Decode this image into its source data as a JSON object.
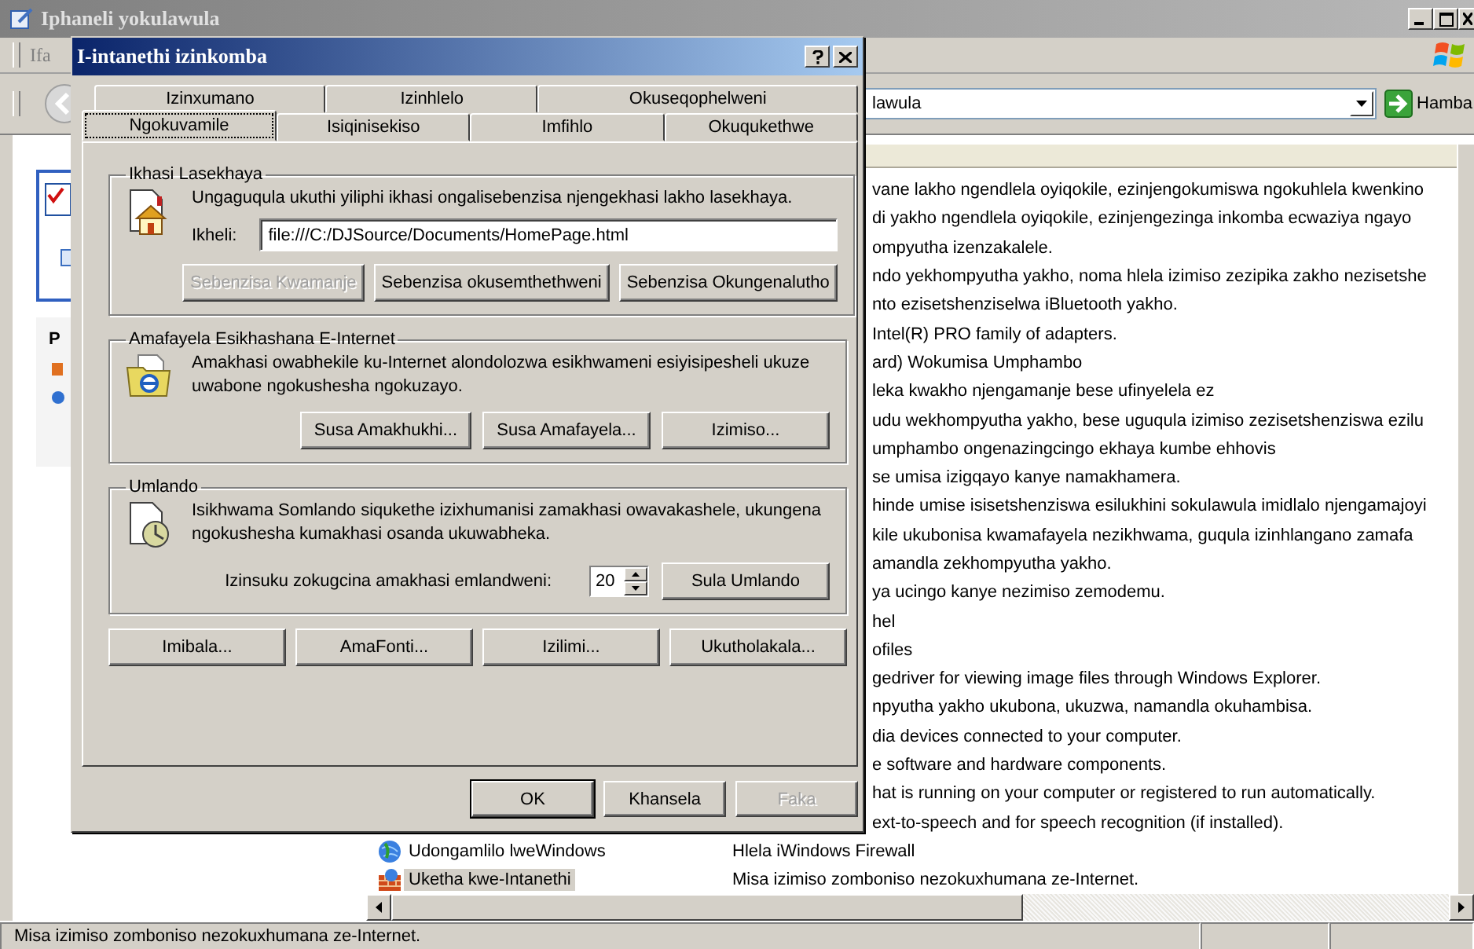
{
  "window": {
    "title": "Iphaneli yokulawula",
    "menu": [
      "Ifa"
    ],
    "address": "lawula",
    "go_button": "Hamba"
  },
  "left_panel": {
    "heading": "P"
  },
  "list": {
    "rows": [
      {
        "kind": "covered",
        "description": "vane lakho ngendlela oyiqokile, ezinjengokumiswa ngokuhlela kwenkino",
        "selected": false
      },
      {
        "kind": "covered",
        "description": "di yakho ngendlela oyiqokile, ezinjengezinga inkomba ecwaziya ngayo",
        "selected": false
      },
      {
        "kind": "covered",
        "description": "ompyutha izenzakalele.",
        "selected": false
      },
      {
        "kind": "covered",
        "description": "ndo yekhompyutha yakho, noma hlela izimiso zezipika zakho nezisetshe",
        "selected": false
      },
      {
        "kind": "covered",
        "description": "nto ezisetshenziselwa iBluetooth yakho.",
        "selected": false
      },
      {
        "kind": "covered",
        "description": "Intel(R) PRO family of adapters.",
        "selected": false
      },
      {
        "kind": "covered",
        "description": "ard) Wokumisa Umphambo",
        "selected": false
      },
      {
        "kind": "covered",
        "description": "leka kwakho njengamanje bese ufinyelela ez",
        "selected": false
      },
      {
        "kind": "covered",
        "description": "udu wekhompyutha yakho, bese uguqula izimiso zezisetshenziswa ezilu",
        "selected": false
      },
      {
        "kind": "covered",
        "description": "umphambo ongenazingcingo ekhaya kumbe ehhovis",
        "selected": false
      },
      {
        "kind": "covered",
        "description": "se umisa izigqayo kanye namakhamera.",
        "selected": false
      },
      {
        "kind": "covered",
        "description": "hinde umise isisetshenziswa esilukhini sokulawula imidlalo njengamajoyi",
        "selected": false
      },
      {
        "kind": "covered",
        "description": "kile ukubonisa kwamafayela nezikhwama, guqula izinhlangano zamafa",
        "selected": false
      },
      {
        "kind": "covered",
        "description": "amandla zekhompyutha yakho.",
        "selected": false
      },
      {
        "kind": "covered",
        "description": "ya ucingo kanye nezimiso zemodemu.",
        "selected": false
      },
      {
        "kind": "covered",
        "description": "hel",
        "selected": false
      },
      {
        "kind": "covered",
        "description": "ofiles",
        "selected": false
      },
      {
        "kind": "covered",
        "description": "gedriver for viewing image files through Windows Explorer.",
        "selected": false
      },
      {
        "kind": "covered",
        "description": "npyutha yakho ukubona, ukuzwa, namandla okuhambisa.",
        "selected": false
      },
      {
        "kind": "covered",
        "description": "dia devices connected to your computer.",
        "selected": false
      },
      {
        "kind": "covered",
        "description": "e software and hardware components.",
        "selected": false
      },
      {
        "kind": "covered",
        "description": "hat is running on your computer or registered to run automatically.",
        "selected": false
      },
      {
        "kind": "covered",
        "description": "ext-to-speech and for speech recognition (if installed).",
        "selected": false
      },
      {
        "kind": "full",
        "name": "Udongamlilo lweWindows",
        "description": "Hlela iWindows Firewall",
        "selected": false
      },
      {
        "kind": "full",
        "name": "Uketha kwe-Intanethi",
        "description": "Misa izimiso zomboniso nezokuxhumana ze-Internet.",
        "selected": true
      }
    ]
  },
  "status_bar": {
    "text": "Misa izimiso zomboniso nezokuxhumana ze-Internet."
  },
  "dialog": {
    "title": "I-intanethi izinkomba",
    "tabs_back": [
      {
        "label": "Izinxumano",
        "selected": false
      },
      {
        "label": "Izinhlelo",
        "selected": false
      },
      {
        "label": "Okuseqophelweni",
        "selected": false
      }
    ],
    "tabs_front": [
      {
        "label": "Ngokuvamile",
        "selected": true
      },
      {
        "label": "Isiqinisekiso",
        "selected": false
      },
      {
        "label": "Imfihlo",
        "selected": false
      },
      {
        "label": "Okuqukethwe",
        "selected": false
      }
    ],
    "home_page": {
      "legend": "Ikhasi Lasekhaya",
      "text": "Ungaguqula ukuthi yiliphi ikhasi ongalisebenzisa njengekhasi lakho lasekhaya.",
      "address_label": "Ikheli:",
      "address": "file:///C:/DJSource/Documents/HomePage.html",
      "buttons": [
        {
          "label": "Sebenzisa Kwamanje",
          "disabled": true
        },
        {
          "label": "Sebenzisa okusemthethweni",
          "disabled": false
        },
        {
          "label": "Sebenzisa Okungenalutho",
          "disabled": false
        }
      ]
    },
    "temp_files": {
      "legend": "Amafayela Esikhashana E-Internet",
      "text": "Amakhasi owabhekile ku-Internet alondolozwa esikhwameni esiyisipesheli ukuze uwabone ngokushesha ngokuzayo.",
      "buttons": [
        {
          "label": "Susa Amakhukhi...",
          "disabled": false
        },
        {
          "label": "Susa Amafayela...",
          "disabled": false
        },
        {
          "label": "Izimiso...",
          "disabled": false
        }
      ]
    },
    "history": {
      "legend": "Umlando",
      "text": "Isikhwama Somlando siqukethe izixhumanisi zamakhasi owavakashele, ukungena ngokushesha kumakhasi osanda ukuwabheka.",
      "days_label": "Izinsuku zokugcina amakhasi emlandweni:",
      "days": "20",
      "buttons": [
        {
          "label": "Sula Umlando",
          "disabled": false
        }
      ]
    },
    "bottom_buttons": [
      {
        "label": "Imibala...",
        "disabled": false
      },
      {
        "label": "AmaFonti...",
        "disabled": false
      },
      {
        "label": "Izilimi...",
        "disabled": false
      },
      {
        "label": "Ukutholakala...",
        "disabled": false
      }
    ],
    "footer_buttons": [
      {
        "label": "OK",
        "default": true,
        "disabled": false
      },
      {
        "label": "Khansela",
        "default": false,
        "disabled": false
      },
      {
        "label": "Faka",
        "default": false,
        "disabled": true
      }
    ]
  }
}
